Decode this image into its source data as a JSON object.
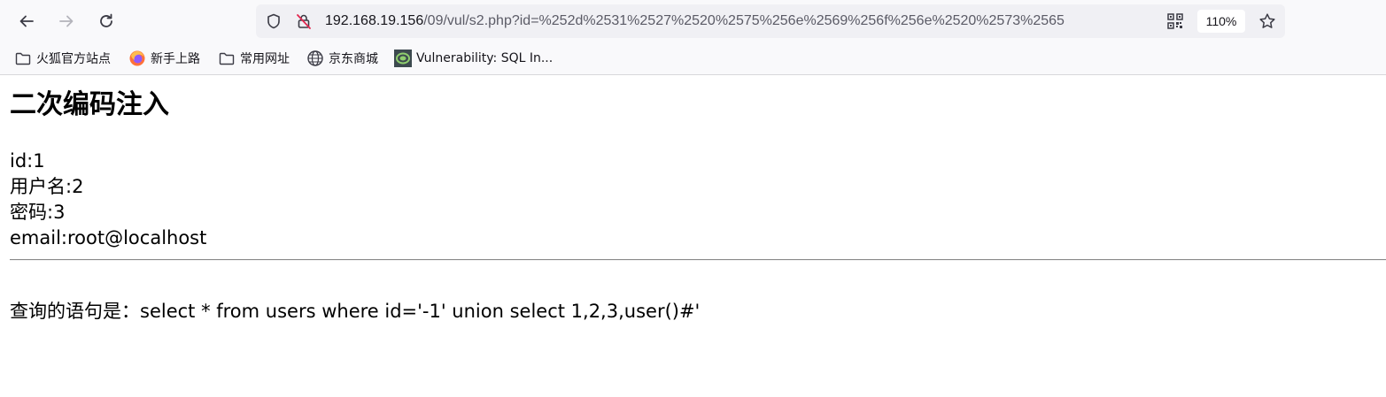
{
  "browser": {
    "url_host": "192.168.19.156",
    "url_path": "/09/vul/s2.php?id=%252d%2531%2527%2520%2575%256e%2569%256f%256e%2520%2573%2565",
    "zoom": "110%"
  },
  "bookmarks": [
    {
      "label": "火狐官方站点",
      "icon": "folder-icon"
    },
    {
      "label": "新手上路",
      "icon": "firefox-icon"
    },
    {
      "label": "常用网址",
      "icon": "folder-icon"
    },
    {
      "label": "京东商城",
      "icon": "globe-icon"
    },
    {
      "label": "Vulnerability: SQL In...",
      "icon": "dvwa-favicon-icon"
    }
  ],
  "page": {
    "title": "二次编码注入",
    "fields": [
      "id:1",
      "用户名:2",
      "密码:3",
      "email:root@localhost"
    ],
    "query": "查询的语句是：select * from users where id='-1' union select 1,2,3,user()#'"
  }
}
